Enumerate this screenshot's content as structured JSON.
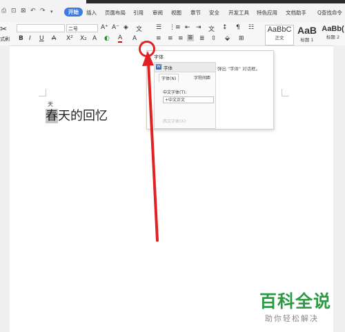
{
  "quick_access": {
    "icons": [
      "print-icon",
      "print-preview-icon",
      "undo-icon",
      "redo-icon",
      "dropdown-icon"
    ]
  },
  "menu": {
    "tabs": [
      "开始",
      "插入",
      "页面布局",
      "引用",
      "审阅",
      "视图",
      "章节",
      "安全",
      "开发工具",
      "特色应用",
      "文档助手"
    ],
    "active_tab": "开始",
    "search": "Q查找命令"
  },
  "ribbon": {
    "font_name": "",
    "font_size": "二号",
    "format_painter_label": "式刷",
    "bold": "B",
    "italic": "I",
    "underline": "U",
    "strike": "A",
    "superscript": "X²",
    "subscript": "X₂",
    "styles": [
      {
        "sample": "AaBbC",
        "label": "正文"
      },
      {
        "sample": "AaB",
        "label": "标题 1"
      },
      {
        "sample": "AaBb(",
        "label": "标题 2"
      }
    ]
  },
  "popup": {
    "title": "字体",
    "description": "弹出 \"字体\" 对话框。",
    "dialog": {
      "title": "字体",
      "tabs": [
        "字体(N)",
        "字符间距"
      ],
      "field_label": "中文字体(T):",
      "field_value": "+中文正文",
      "second_field_label": "西文字体(X):"
    }
  },
  "document": {
    "ruby": "天",
    "first_char": "春",
    "rest": "天的回忆"
  },
  "watermark": {
    "main": "百科全说",
    "sub": "助你轻松解决"
  },
  "colors": {
    "accent": "#3d7be4",
    "annotation": "#e02222",
    "watermark": "#2b9a42"
  }
}
